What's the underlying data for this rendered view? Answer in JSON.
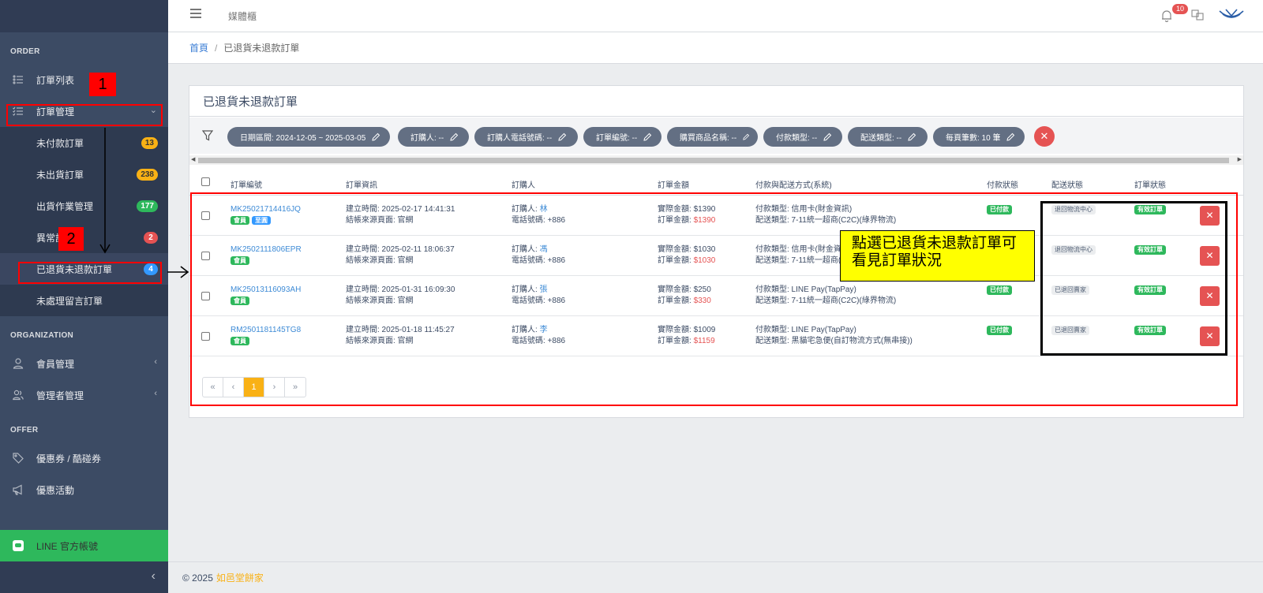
{
  "header": {
    "title": "媒體櫃",
    "notification_count": "10"
  },
  "breadcrumb": {
    "home": "首頁",
    "separator": "/",
    "current": "已退貨未退款訂單"
  },
  "sidebar": {
    "sections": {
      "order": "ORDER",
      "organization": "ORGANIZATION",
      "offer": "OFFER"
    },
    "order_list": "訂單列表",
    "order_manage": "訂單管理",
    "sub": {
      "unpaid": {
        "label": "未付款訂單",
        "count": "13"
      },
      "unshipped": {
        "label": "未出貨訂單",
        "count": "238"
      },
      "shipping_ops": {
        "label": "出貨作業管理",
        "count": "177"
      },
      "abnormal": {
        "label": "異常訂",
        "count": "2"
      },
      "returned_unrefunded": {
        "label": "已退貨未退款訂單",
        "count": "4"
      },
      "unhandled_msg": {
        "label": "未處理留言訂單"
      }
    },
    "member_manage": "會員管理",
    "admin_manage": "管理者管理",
    "coupons": "優惠券 / 酷碰券",
    "promotions": "優惠活動",
    "line_official": "LINE 官方帳號",
    "collapse_glyph": "‹"
  },
  "card": {
    "title": "已退貨未退款訂單"
  },
  "filters": {
    "date_range": "日期區間: 2024-12-05 ~ 2025-03-05",
    "buyer": "訂購人: --",
    "buyer_phone": "訂購人電話號碼: --",
    "order_no": "訂單編號: --",
    "product_name": "購買商品名稱: --",
    "payment_type": "付款類型: --",
    "delivery_type": "配送類型: --",
    "per_page": "每頁筆數: 10 筆"
  },
  "table": {
    "headers": {
      "order_no": "訂單編號",
      "order_info": "訂單資訊",
      "buyer": "訂購人",
      "amount": "訂單金額",
      "pay_ship": "付款與配送方式(系統)",
      "pay_status": "付款狀態",
      "ship_status": "配送狀態",
      "order_status": "訂單狀態"
    },
    "rows": [
      {
        "order_no": "MK25021714416JQ",
        "tags": [
          "會員",
          "至圓"
        ],
        "created": "建立時間: 2025-02-17 14:41:31",
        "source": "結帳來源頁面: 官網",
        "buyer_label": "訂購人: ",
        "buyer_name": "林",
        "phone": "電話號碼: +886",
        "actual_label": "實際金額: ",
        "actual": "$1390",
        "total_label": "訂單金額: ",
        "total": "$1390",
        "pay_type": "付款類型: 信用卡(財金資訊)",
        "ship_type": "配送類型: 7-11統一超商(C2C)(綠界物流)",
        "pay_status": "已付款",
        "ship_status": "退回物流中心",
        "order_status": "有效訂單"
      },
      {
        "order_no": "MK2502111806EPR",
        "tags": [
          "會員"
        ],
        "created": "建立時間: 2025-02-11 18:06:37",
        "source": "結帳來源頁面: 官網",
        "buyer_label": "訂購人: ",
        "buyer_name": "馮",
        "phone": "電話號碼: +886",
        "actual_label": "實際金額: ",
        "actual": "$1030",
        "total_label": "訂單金額: ",
        "total": "$1030",
        "pay_type": "付款類型: 信用卡(財金資",
        "ship_type": "配送類型: 7-11統一超商(",
        "pay_status": "",
        "ship_status": "退回物流中心",
        "order_status": "有效訂單"
      },
      {
        "order_no": "MK25013116093AH",
        "tags": [
          "會員"
        ],
        "created": "建立時間: 2025-01-31 16:09:30",
        "source": "結帳來源頁面: 官網",
        "buyer_label": "訂購人: ",
        "buyer_name": "張",
        "phone": "電話號碼: +886",
        "actual_label": "實際金額: ",
        "actual": "$250",
        "total_label": "訂單金額: ",
        "total": "$330",
        "pay_type": "付款類型: LINE Pay(TapPay)",
        "ship_type": "配送類型: 7-11統一超商(C2C)(綠界物流)",
        "pay_status": "已付款",
        "ship_status": "已退回賣家",
        "order_status": "有效訂單"
      },
      {
        "order_no": "RM2501181145TG8",
        "tags": [
          "會員"
        ],
        "created": "建立時間: 2025-01-18 11:45:27",
        "source": "結帳來源頁面: 官網",
        "buyer_label": "訂購人: ",
        "buyer_name": "李",
        "phone": "電話號碼: +886",
        "actual_label": "實際金額: ",
        "actual": "$1009",
        "total_label": "訂單金額: ",
        "total": "$1159",
        "pay_type": "付款類型: LINE Pay(TapPay)",
        "ship_type": "配送類型: 黑貓宅急便(自訂物流方式(無串接))",
        "pay_status": "已付款",
        "ship_status": "已退回賣家",
        "order_status": "有效訂單"
      }
    ]
  },
  "pagination": {
    "first": "«",
    "prev": "‹",
    "current": "1",
    "next": "›",
    "last": "»"
  },
  "footer": {
    "copyright": "© 2025",
    "brand": "如邑堂餅家"
  },
  "annotations": {
    "step1": "1",
    "step2": "2",
    "callout_line1": "點選已退貨未退款訂單可",
    "callout_line2": "看見訂單狀況"
  }
}
